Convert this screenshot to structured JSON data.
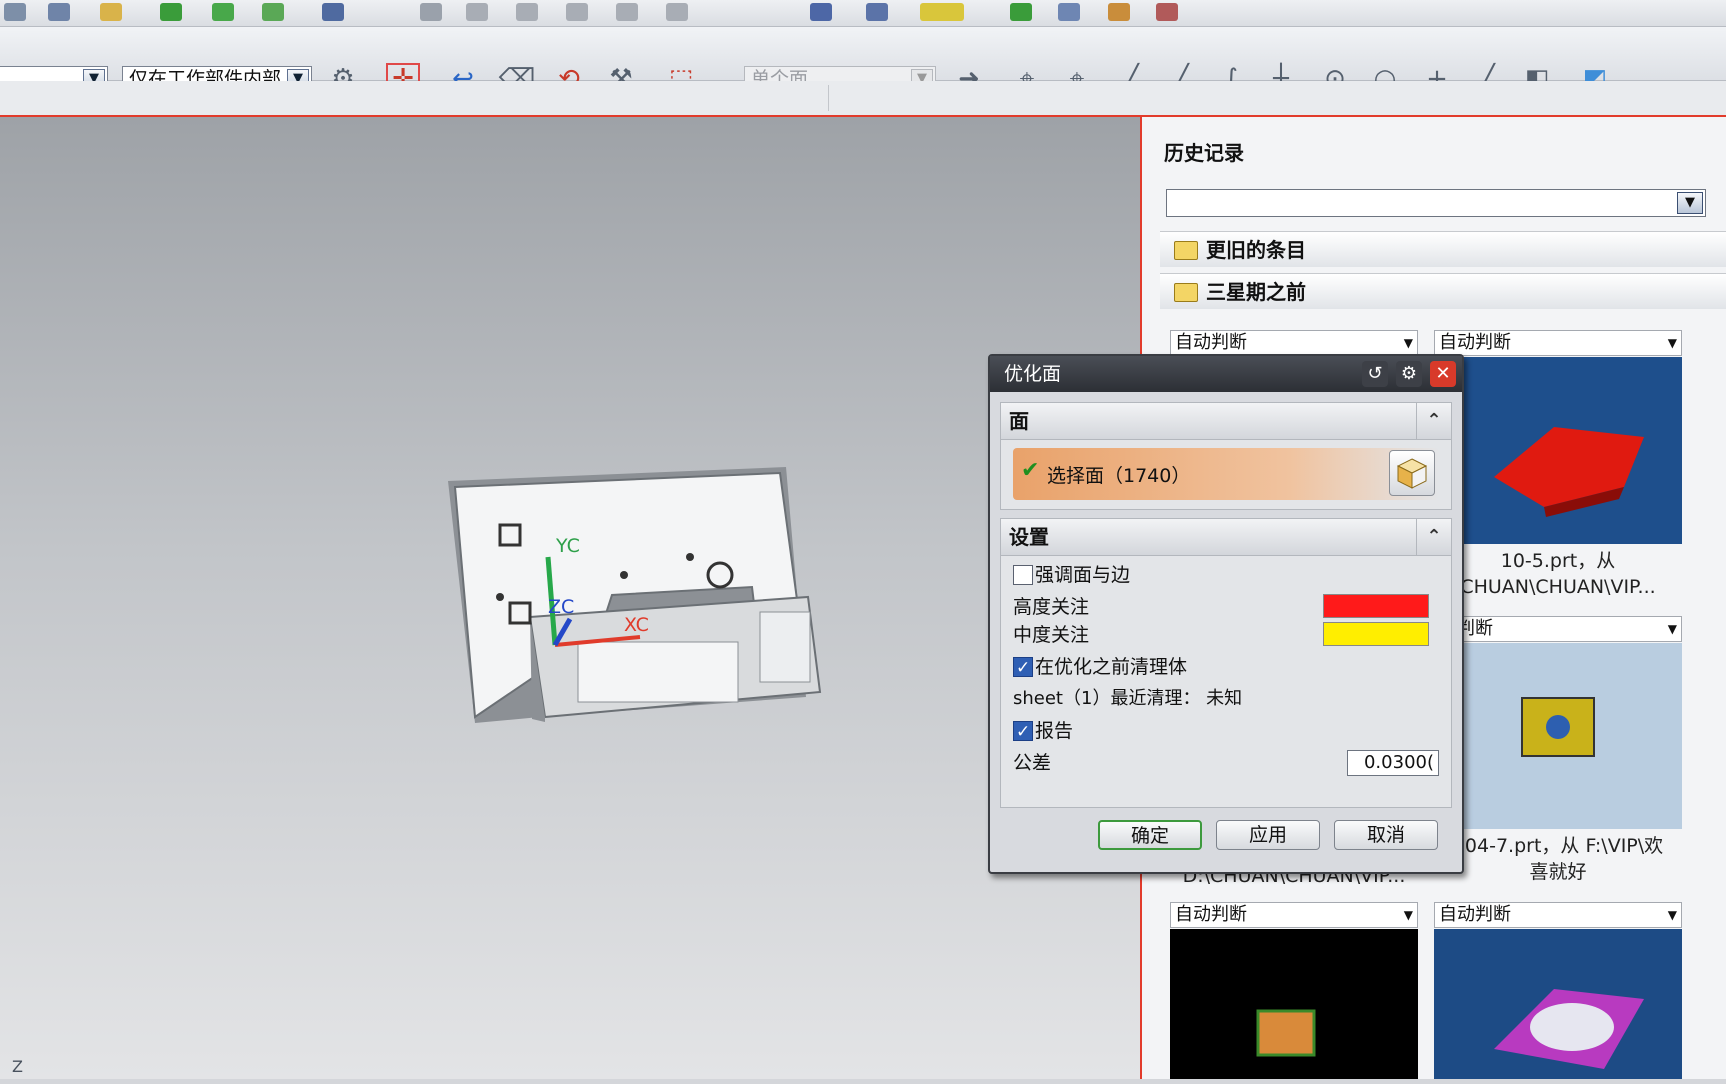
{
  "toolbar": {
    "filter_value": "",
    "scope_value": "仅在工作部件内部",
    "face_rule_value": "单个面"
  },
  "viewport": {
    "axis_yc": "YC",
    "axis_zc": "ZC",
    "axis_xc": "XC",
    "corner_label": "Z"
  },
  "history": {
    "title": "历史记录",
    "search_value": "",
    "groups": [
      "更旧的条目",
      "三星期之前"
    ],
    "cards": [
      {
        "filter": "自动判断",
        "caption1": "",
        "caption2": "D:\\CHUAN\\CHUAN\\VIP..."
      },
      {
        "filter": "自动判断",
        "caption1": "10-5.prt，从",
        "caption2": "CHUAN\\CHUAN\\VIP..."
      },
      {
        "filter": "动判断",
        "caption1": "504-7.prt，从 F:\\VIP\\欢",
        "caption2": "喜就好"
      },
      {
        "filter": "自动判断",
        "caption1": "",
        "caption2": ""
      },
      {
        "filter": "自动判断",
        "caption1": "",
        "caption2": ""
      }
    ]
  },
  "dialog": {
    "title": "优化面",
    "section_face": "面",
    "select_face_label": "选择面（1740）",
    "section_settings": "设置",
    "emphasize_label": "强调面与边",
    "emphasize_checked": false,
    "high_attention_label": "高度关注",
    "high_attention_color": "#ff1a1a",
    "medium_attention_label": "中度关注",
    "medium_attention_color": "#ffee00",
    "clean_before_label": "在优化之前清理体",
    "clean_before_checked": true,
    "recent_clean_text": "sheet（1）最近清理：  未知",
    "report_label": "报告",
    "report_checked": true,
    "tolerance_label": "公差",
    "tolerance_value": "0.0300(",
    "ok_label": "确定",
    "apply_label": "应用",
    "cancel_label": "取消"
  }
}
